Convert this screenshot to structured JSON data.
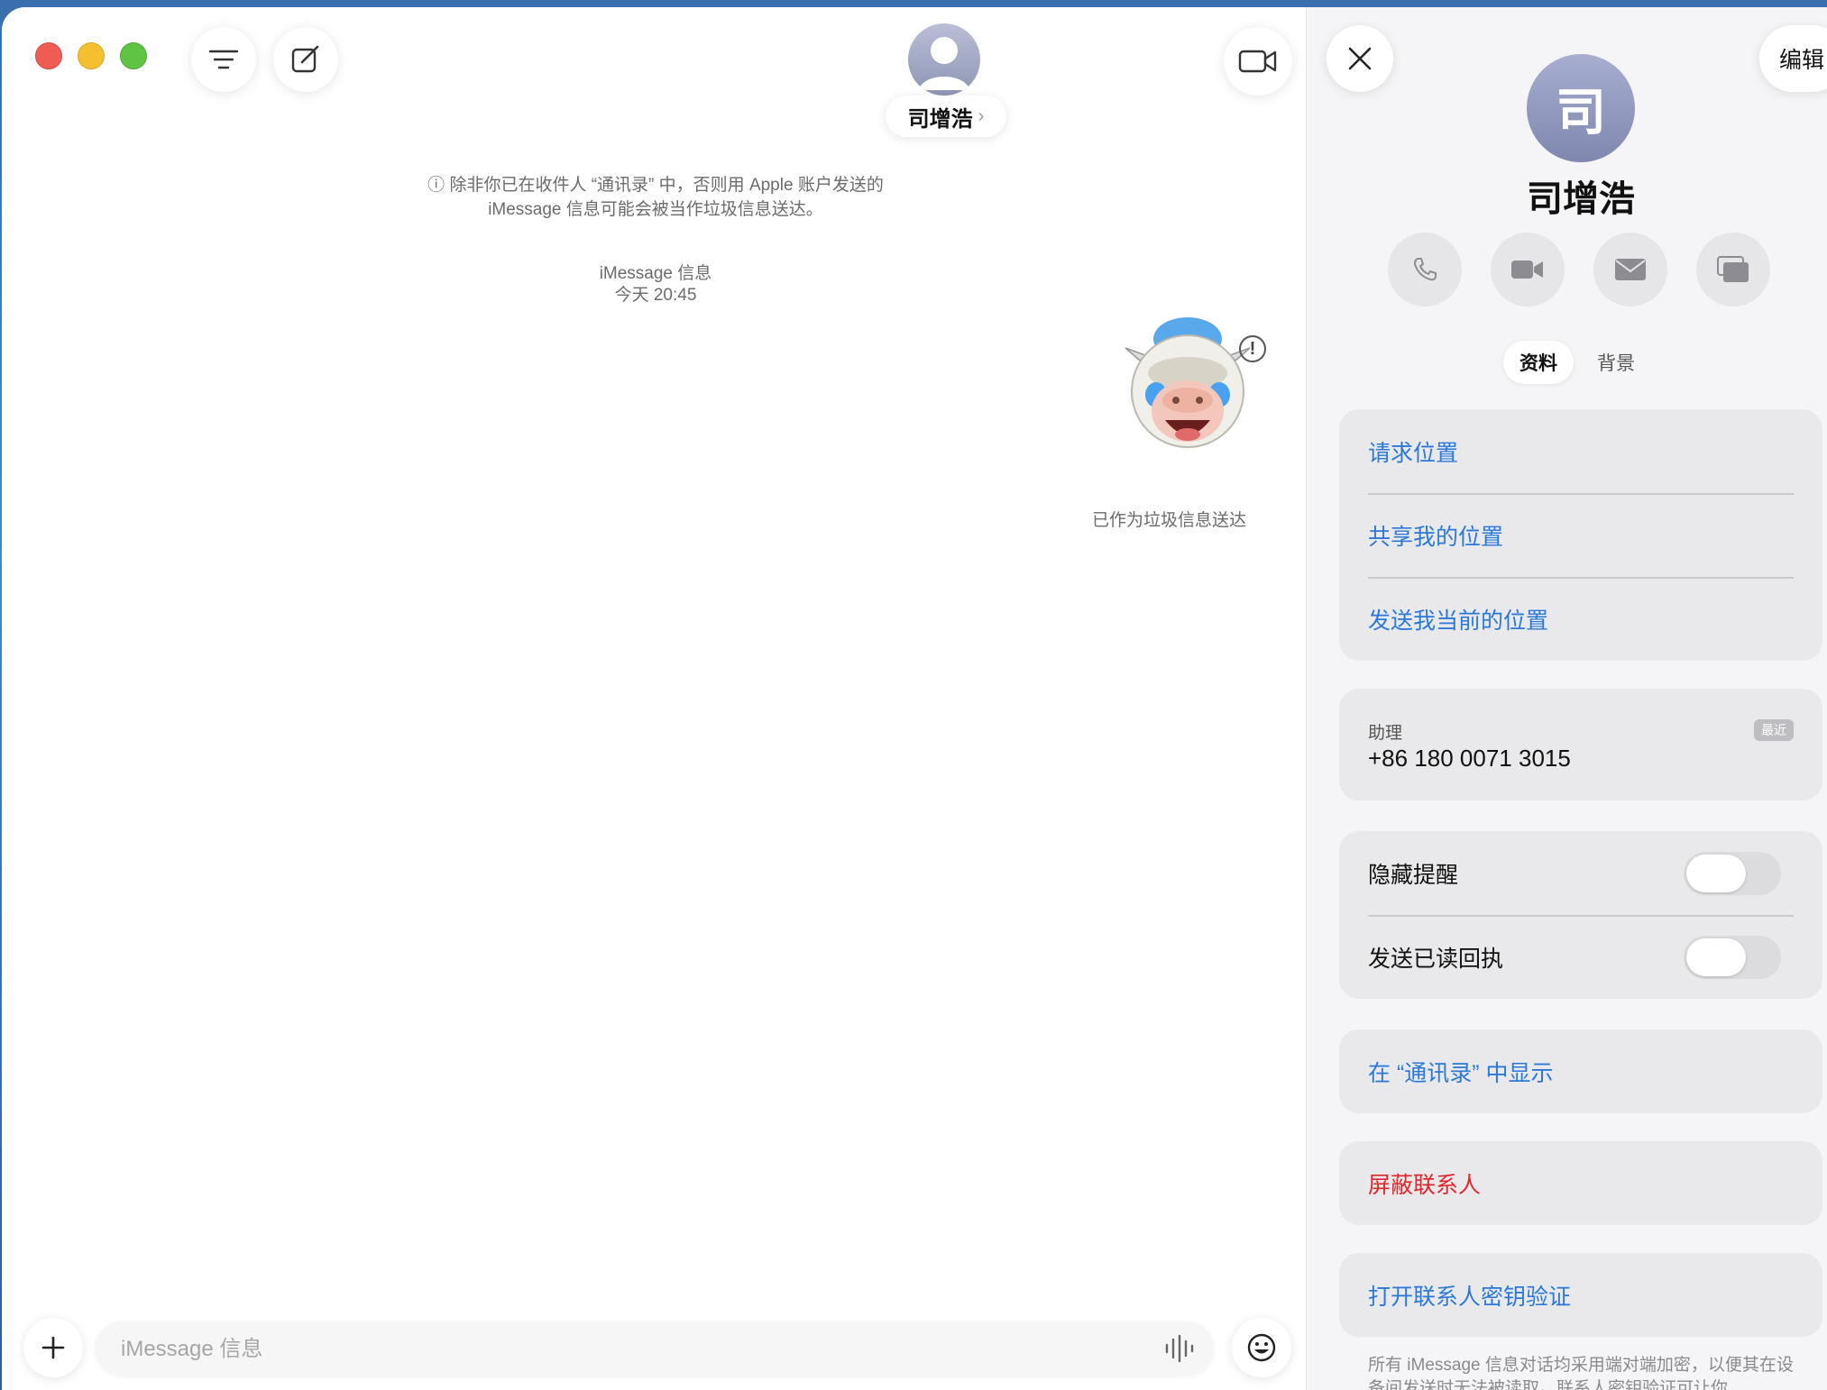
{
  "conversation": {
    "contact_name": "司增浩",
    "chevron": "›",
    "notice_line1": "ⓘ 除非你已在收件人 “通讯录” 中，否则用 Apple 账户发送的",
    "notice_line2": "iMessage 信息可能会被当作垃圾信息送达。",
    "service_label": "iMessage 信息",
    "timestamp": "今天 20:45",
    "alert_glyph": "!",
    "delivered_status": "已作为垃圾信息送达",
    "input_placeholder": "iMessage 信息"
  },
  "icons": {
    "filter": "filter-lines-icon",
    "compose": "compose-icon",
    "video": "video-camera-icon",
    "avatar": "person-avatar-icon",
    "memoji": "cow-memoji-crying-icon",
    "alert": "exclamation-circle-icon",
    "plus": "plus-icon",
    "audio": "waveform-icon",
    "emoji": "emoji-face-icon",
    "close": "close-x-icon",
    "phone": "phone-icon",
    "facetime": "video-icon",
    "mail": "envelope-icon",
    "screen": "screen-share-icon"
  },
  "info_panel": {
    "edit_label": "编辑",
    "avatar_initial": "司",
    "name": "司增浩",
    "tabs": [
      {
        "label": "资料",
        "active": true
      },
      {
        "label": "背景",
        "active": false
      }
    ],
    "location_items": [
      "请求位置",
      "共享我的位置",
      "发送我当前的位置"
    ],
    "phone": {
      "label": "助理",
      "number": "+86 180 0071 3015",
      "badge": "最近"
    },
    "toggles": [
      {
        "label": "隐藏提醒",
        "on": false
      },
      {
        "label": "发送已读回执",
        "on": false
      }
    ],
    "show_in_contacts": "在 “通讯录” 中显示",
    "block_contact": "屏蔽联系人",
    "key_verification": "打开联系人密钥验证",
    "footnote": "所有 iMessage 信息对话均采用端对端加密，以便其在设备间发送时无法被读取。联系人密钥验证可让你"
  },
  "colors": {
    "link_blue": "#2a78d8",
    "destructive_red": "#e0262b",
    "traffic_red": "#ee5c54",
    "traffic_yellow": "#f5bf2f",
    "traffic_green": "#5ec443"
  }
}
